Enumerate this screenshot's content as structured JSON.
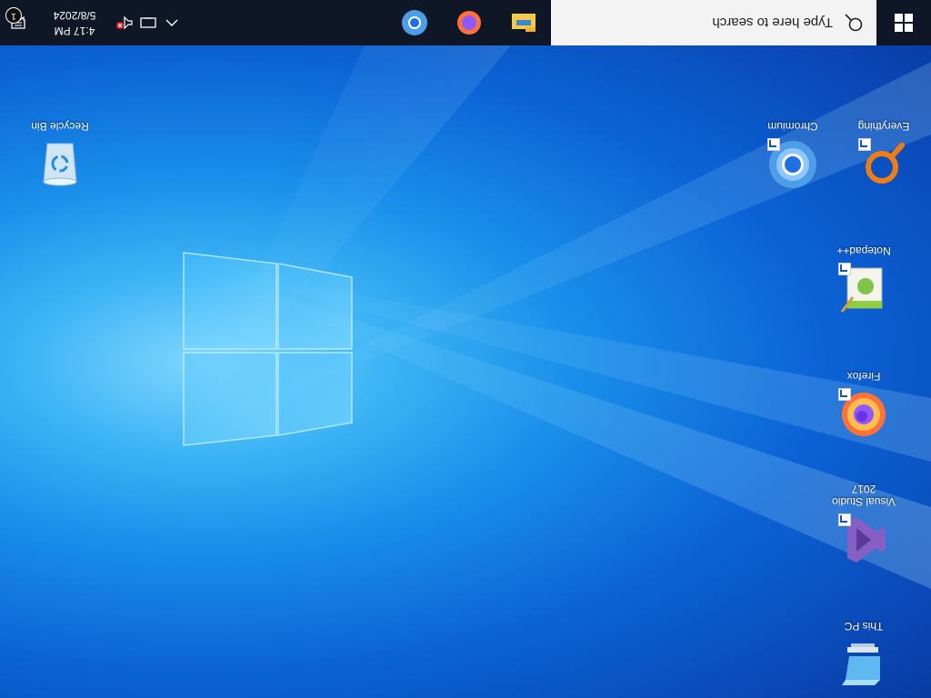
{
  "desktop": {
    "icons_left": [
      {
        "label": "This PC"
      },
      {
        "label": "Visual Studio 2017"
      },
      {
        "label": "Firefox"
      },
      {
        "label": "Notepad++"
      },
      {
        "label": "Everything"
      },
      {
        "label": "Chromium"
      }
    ],
    "recycle_bin": {
      "label": "Recycle Bin"
    }
  },
  "taskbar": {
    "search_placeholder": "Type here to search",
    "apps": [
      "file-explorer-icon",
      "firefox-icon",
      "chromium-icon"
    ],
    "clock": {
      "time": "4:17 PM",
      "date": "5/8/2024"
    },
    "notification_count": "1"
  },
  "colors": {
    "taskbar": "#0f1726",
    "search_bg": "#f3f3f3",
    "desktop_accent": "#0b63d6"
  }
}
